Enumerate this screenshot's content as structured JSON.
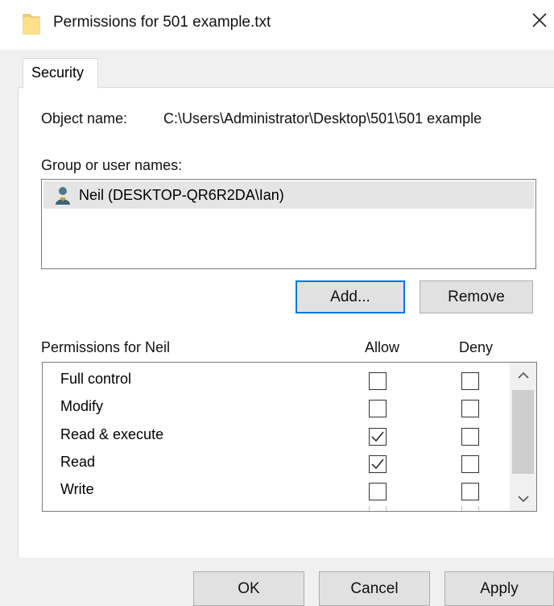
{
  "window": {
    "title": "Permissions for 501 example.txt",
    "icons": {
      "title": "folder-icon",
      "close": "close-icon"
    }
  },
  "tabs": [
    {
      "label": "Security",
      "selected": true
    }
  ],
  "object": {
    "label": "Object name:",
    "value": "C:\\Users\\Administrator\\Desktop\\501\\501 example"
  },
  "groups": {
    "label": "Group or user names:",
    "items": [
      {
        "name": "Neil (DESKTOP-QR6R2DA\\Ian)",
        "icon": "user-icon",
        "selected": true
      }
    ],
    "add_label": "Add...",
    "remove_label": "Remove"
  },
  "permissions": {
    "label": "Permissions for Neil",
    "allow_header": "Allow",
    "deny_header": "Deny",
    "rows": [
      {
        "name": "Full control",
        "allow": false,
        "deny": false
      },
      {
        "name": "Modify",
        "allow": false,
        "deny": false
      },
      {
        "name": "Read & execute",
        "allow": true,
        "deny": false
      },
      {
        "name": "Read",
        "allow": true,
        "deny": false
      },
      {
        "name": "Write",
        "allow": false,
        "deny": false
      }
    ]
  },
  "footer": {
    "ok_label": "OK",
    "cancel_label": "Cancel",
    "apply_label": "Apply"
  },
  "colors": {
    "accent": "#0078d7",
    "dialog_bg": "#f0f0f0",
    "selection": "#e5e5e5"
  }
}
